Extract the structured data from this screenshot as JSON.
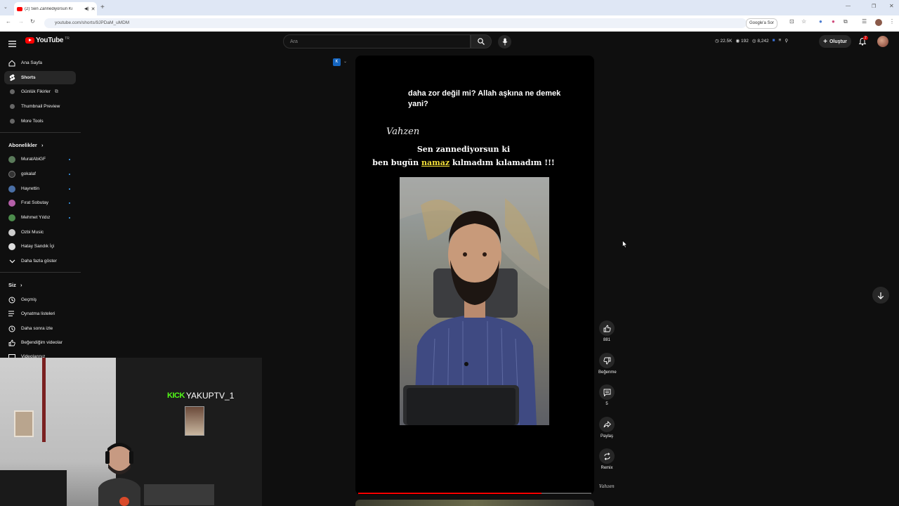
{
  "browser": {
    "tab_title": "(2) Sen Zannediyorsun Ki",
    "url": "youtube.com/shorts/9JPDaM_uMDM",
    "google_lens_label": "Google'a Sor"
  },
  "header": {
    "logo_text": "YouTube",
    "logo_country": "TR",
    "search_placeholder": "Ara",
    "stats": [
      "22.5K",
      "192",
      "8,242"
    ],
    "create_label": "Oluştur",
    "notification_count": "2"
  },
  "sidebar": {
    "primary": [
      {
        "label": "Ana Sayfa",
        "icon": "home-icon"
      },
      {
        "label": "Shorts",
        "icon": "shorts-icon",
        "active": true
      },
      {
        "label": "Günlük Fikirler",
        "icon": "extension-icon"
      },
      {
        "label": "Thumbnail Preview",
        "icon": "extension-icon"
      },
      {
        "label": "More Tools",
        "icon": "extension-icon"
      }
    ],
    "subscriptions_heading": "Abonelikler",
    "subscriptions": [
      {
        "label": "MuratAbiGF",
        "color": "#5a7a5a"
      },
      {
        "label": "gokalaf",
        "color": "#333333"
      },
      {
        "label": "Hayrettin",
        "color": "#4a6fa5"
      },
      {
        "label": "Fırat Sobutay",
        "color": "#b45fa8"
      },
      {
        "label": "Mehmet Yıldız",
        "color": "#4c8c4c"
      },
      {
        "label": "Ozbi Music",
        "color": "#cccccc"
      },
      {
        "label": "Hatay Sandık İçi",
        "color": "#dddddd"
      }
    ],
    "show_more": "Daha fazla göster",
    "you_heading": "Siz",
    "you_items": [
      {
        "label": "Geçmiş",
        "icon": "history-icon"
      },
      {
        "label": "Oynatma listeleri",
        "icon": "playlist-icon"
      },
      {
        "label": "Daha sonra izle",
        "icon": "clock-icon"
      },
      {
        "label": "Beğendiğim videolar",
        "icon": "thumbs-up-icon"
      },
      {
        "label": "Videolarınız",
        "icon": "video-icon"
      }
    ]
  },
  "overlay": {
    "kick_logo": "KICK",
    "streamer_name": "YAKUPTV_1"
  },
  "short": {
    "caption_top": "daha zor değil mi? Allah aşkına ne demek yani?",
    "channel_logo": "Vahzen",
    "caption_line1": "Sen zannediyorsun ki",
    "caption_line2_pre": "ben bugün ",
    "caption_line2_highlight": "namaz",
    "caption_line2_post": "  kılmadım kılamadım !!!",
    "progress_fraction": 0.786
  },
  "actions": [
    {
      "label": "881",
      "icon": "thumbs-up-icon"
    },
    {
      "label": "Beğenme",
      "icon": "thumbs-down-icon"
    },
    {
      "label": "5",
      "icon": "comment-icon"
    },
    {
      "label": "Paylaş",
      "icon": "share-icon"
    },
    {
      "label": "Remix",
      "icon": "remix-icon"
    }
  ],
  "colors": {
    "background": "#0f0f0f",
    "accent_red": "#ff0000",
    "highlight_yellow": "#f5e13a",
    "kick_green": "#53fc18"
  }
}
